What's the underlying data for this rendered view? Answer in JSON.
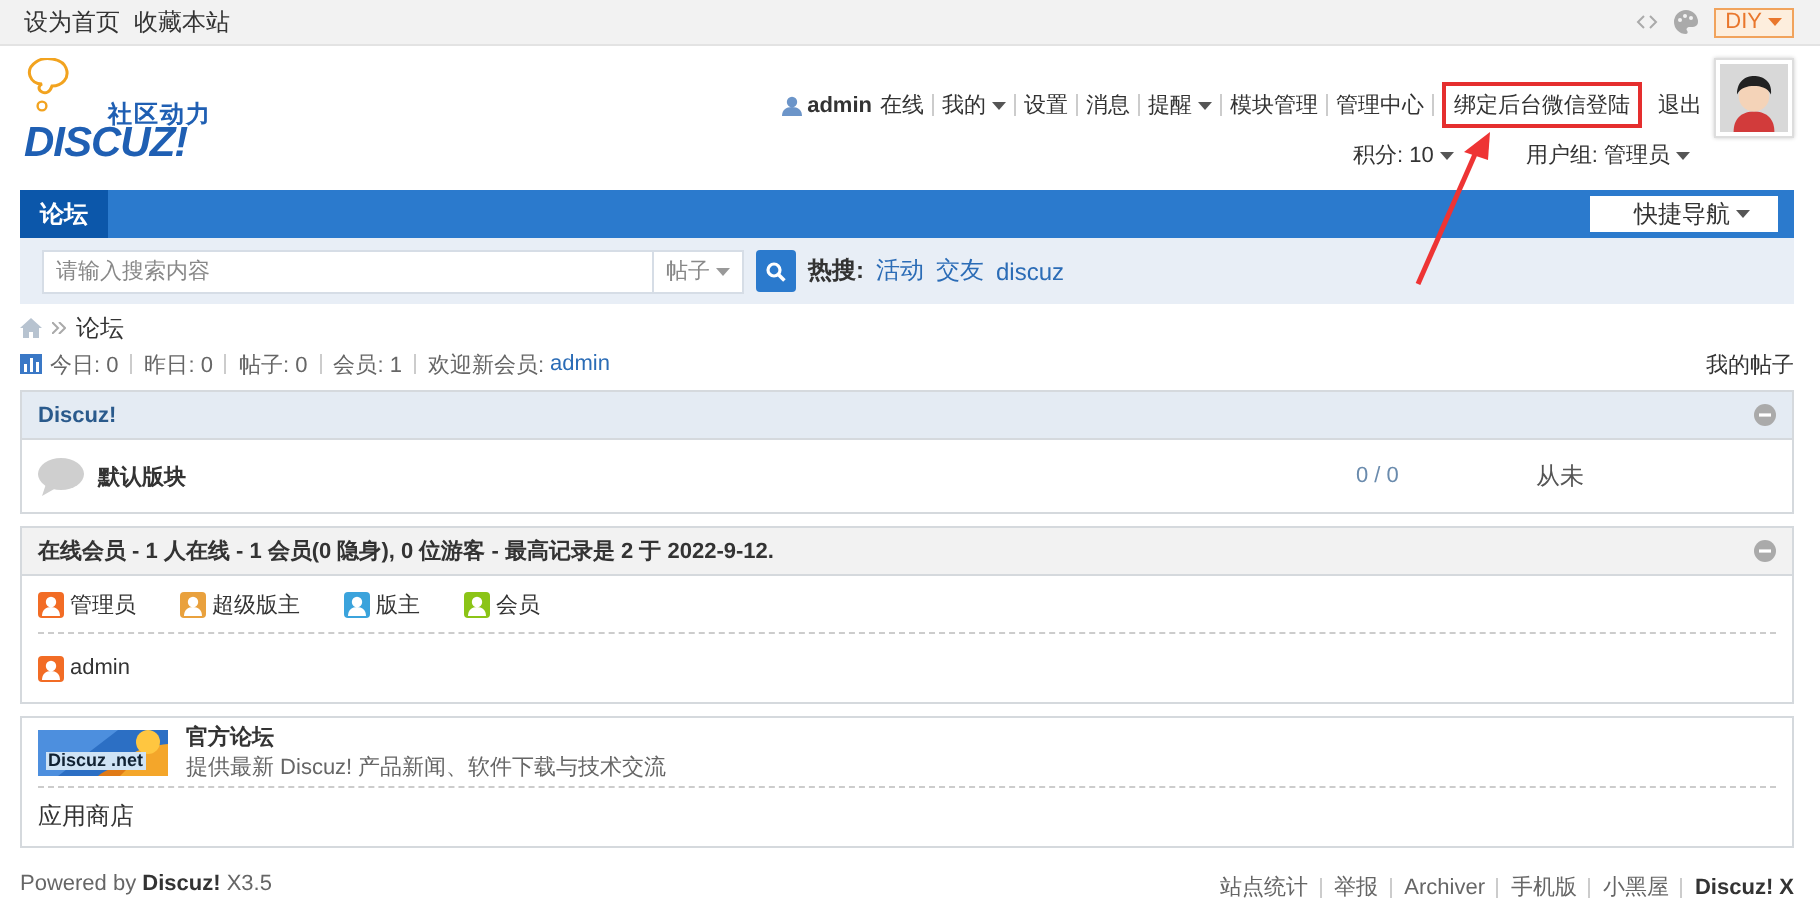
{
  "topbar": {
    "links": [
      "设为首页",
      "收藏本站"
    ],
    "diy_button": "DIY"
  },
  "logo": {
    "tagline": "社区动力",
    "name": "DISCUZ!"
  },
  "user_menu": {
    "username": "admin",
    "status": "在线",
    "items": [
      {
        "label": "我的",
        "dropdown": true,
        "highlighted": false
      },
      {
        "label": "设置",
        "dropdown": false,
        "highlighted": false
      },
      {
        "label": "消息",
        "dropdown": false,
        "highlighted": false
      },
      {
        "label": "提醒",
        "dropdown": true,
        "highlighted": false
      },
      {
        "label": "模块管理",
        "dropdown": false,
        "highlighted": false
      },
      {
        "label": "管理中心",
        "dropdown": false,
        "highlighted": false
      },
      {
        "label": "绑定后台微信登陆",
        "dropdown": false,
        "highlighted": true
      }
    ],
    "logout": "退出",
    "stats": [
      {
        "label": "积分: 10",
        "dropdown": true
      },
      {
        "label": "用户组: 管理员",
        "dropdown": true
      }
    ]
  },
  "nav": {
    "tabs": [
      {
        "label": "论坛",
        "selected": true
      }
    ],
    "quick_nav": "快捷导航"
  },
  "search": {
    "placeholder": "请输入搜索内容",
    "scope": "帖子",
    "hot_label": "热搜:",
    "hot_terms": [
      "活动",
      "交友",
      "discuz"
    ]
  },
  "breadcrumb": [
    "论坛"
  ],
  "stats": {
    "items": [
      "今日: 0",
      "昨日: 0",
      "帖子: 0",
      "会员: 1"
    ],
    "welcome": "欢迎新会员:",
    "new_member": "admin",
    "my_posts": "我的帖子"
  },
  "categories": [
    {
      "title": "Discuz!",
      "forums": [
        {
          "name": "默认版块",
          "counts": "0 / 0",
          "last_post": "从未"
        }
      ]
    }
  ],
  "online": {
    "title": "在线会员 - 1 人在线 - 1 会员(0 隐身), 0 位游客 - 最高记录是 2 于 2022-9-12.",
    "legend": [
      {
        "label": "管理员",
        "color": "#f26c25"
      },
      {
        "label": "超级版主",
        "color": "#e9a13d"
      },
      {
        "label": "版主",
        "color": "#3ba3dc"
      },
      {
        "label": "会员",
        "color": "#8bc417"
      }
    ],
    "users": [
      {
        "name": "admin",
        "color": "#f26c25"
      }
    ]
  },
  "links": {
    "featured": {
      "banner": "Discuz .net",
      "title": "官方论坛",
      "description": "提供最新 Discuz! 产品新闻、软件下载与技术交流"
    },
    "text_links": [
      "应用商店"
    ]
  },
  "footer": {
    "powered": "Powered by **Discuz!** X3.5",
    "links": [
      "站点统计",
      "举报",
      "Archiver",
      "手机版",
      "小黑屋"
    ],
    "brand": "Discuz! X"
  }
}
